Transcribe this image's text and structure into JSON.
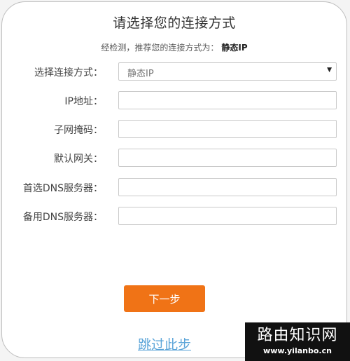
{
  "form": {
    "title": "请选择您的连接方式",
    "detect_prefix": "经检测，推荐您的连接方式为：",
    "detect_result": "静态IP",
    "connection_type": {
      "label": "选择连接方式：",
      "value": "静态IP"
    },
    "ip_address": {
      "label": "IP地址：",
      "value": ""
    },
    "subnet_mask": {
      "label": "子网掩码：",
      "value": ""
    },
    "gateway": {
      "label": "默认网关：",
      "value": ""
    },
    "primary_dns": {
      "label": "首选DNS服务器：",
      "value": ""
    },
    "secondary_dns": {
      "label": "备用DNS服务器：",
      "value": ""
    },
    "next_label": "下一步",
    "skip_label": "跳过此步"
  },
  "watermark": {
    "title": "路由知识网",
    "url": "www.yilanbo.cn"
  },
  "colors": {
    "primary_button": "#f07316",
    "skip_link": "#5aa4d8"
  }
}
